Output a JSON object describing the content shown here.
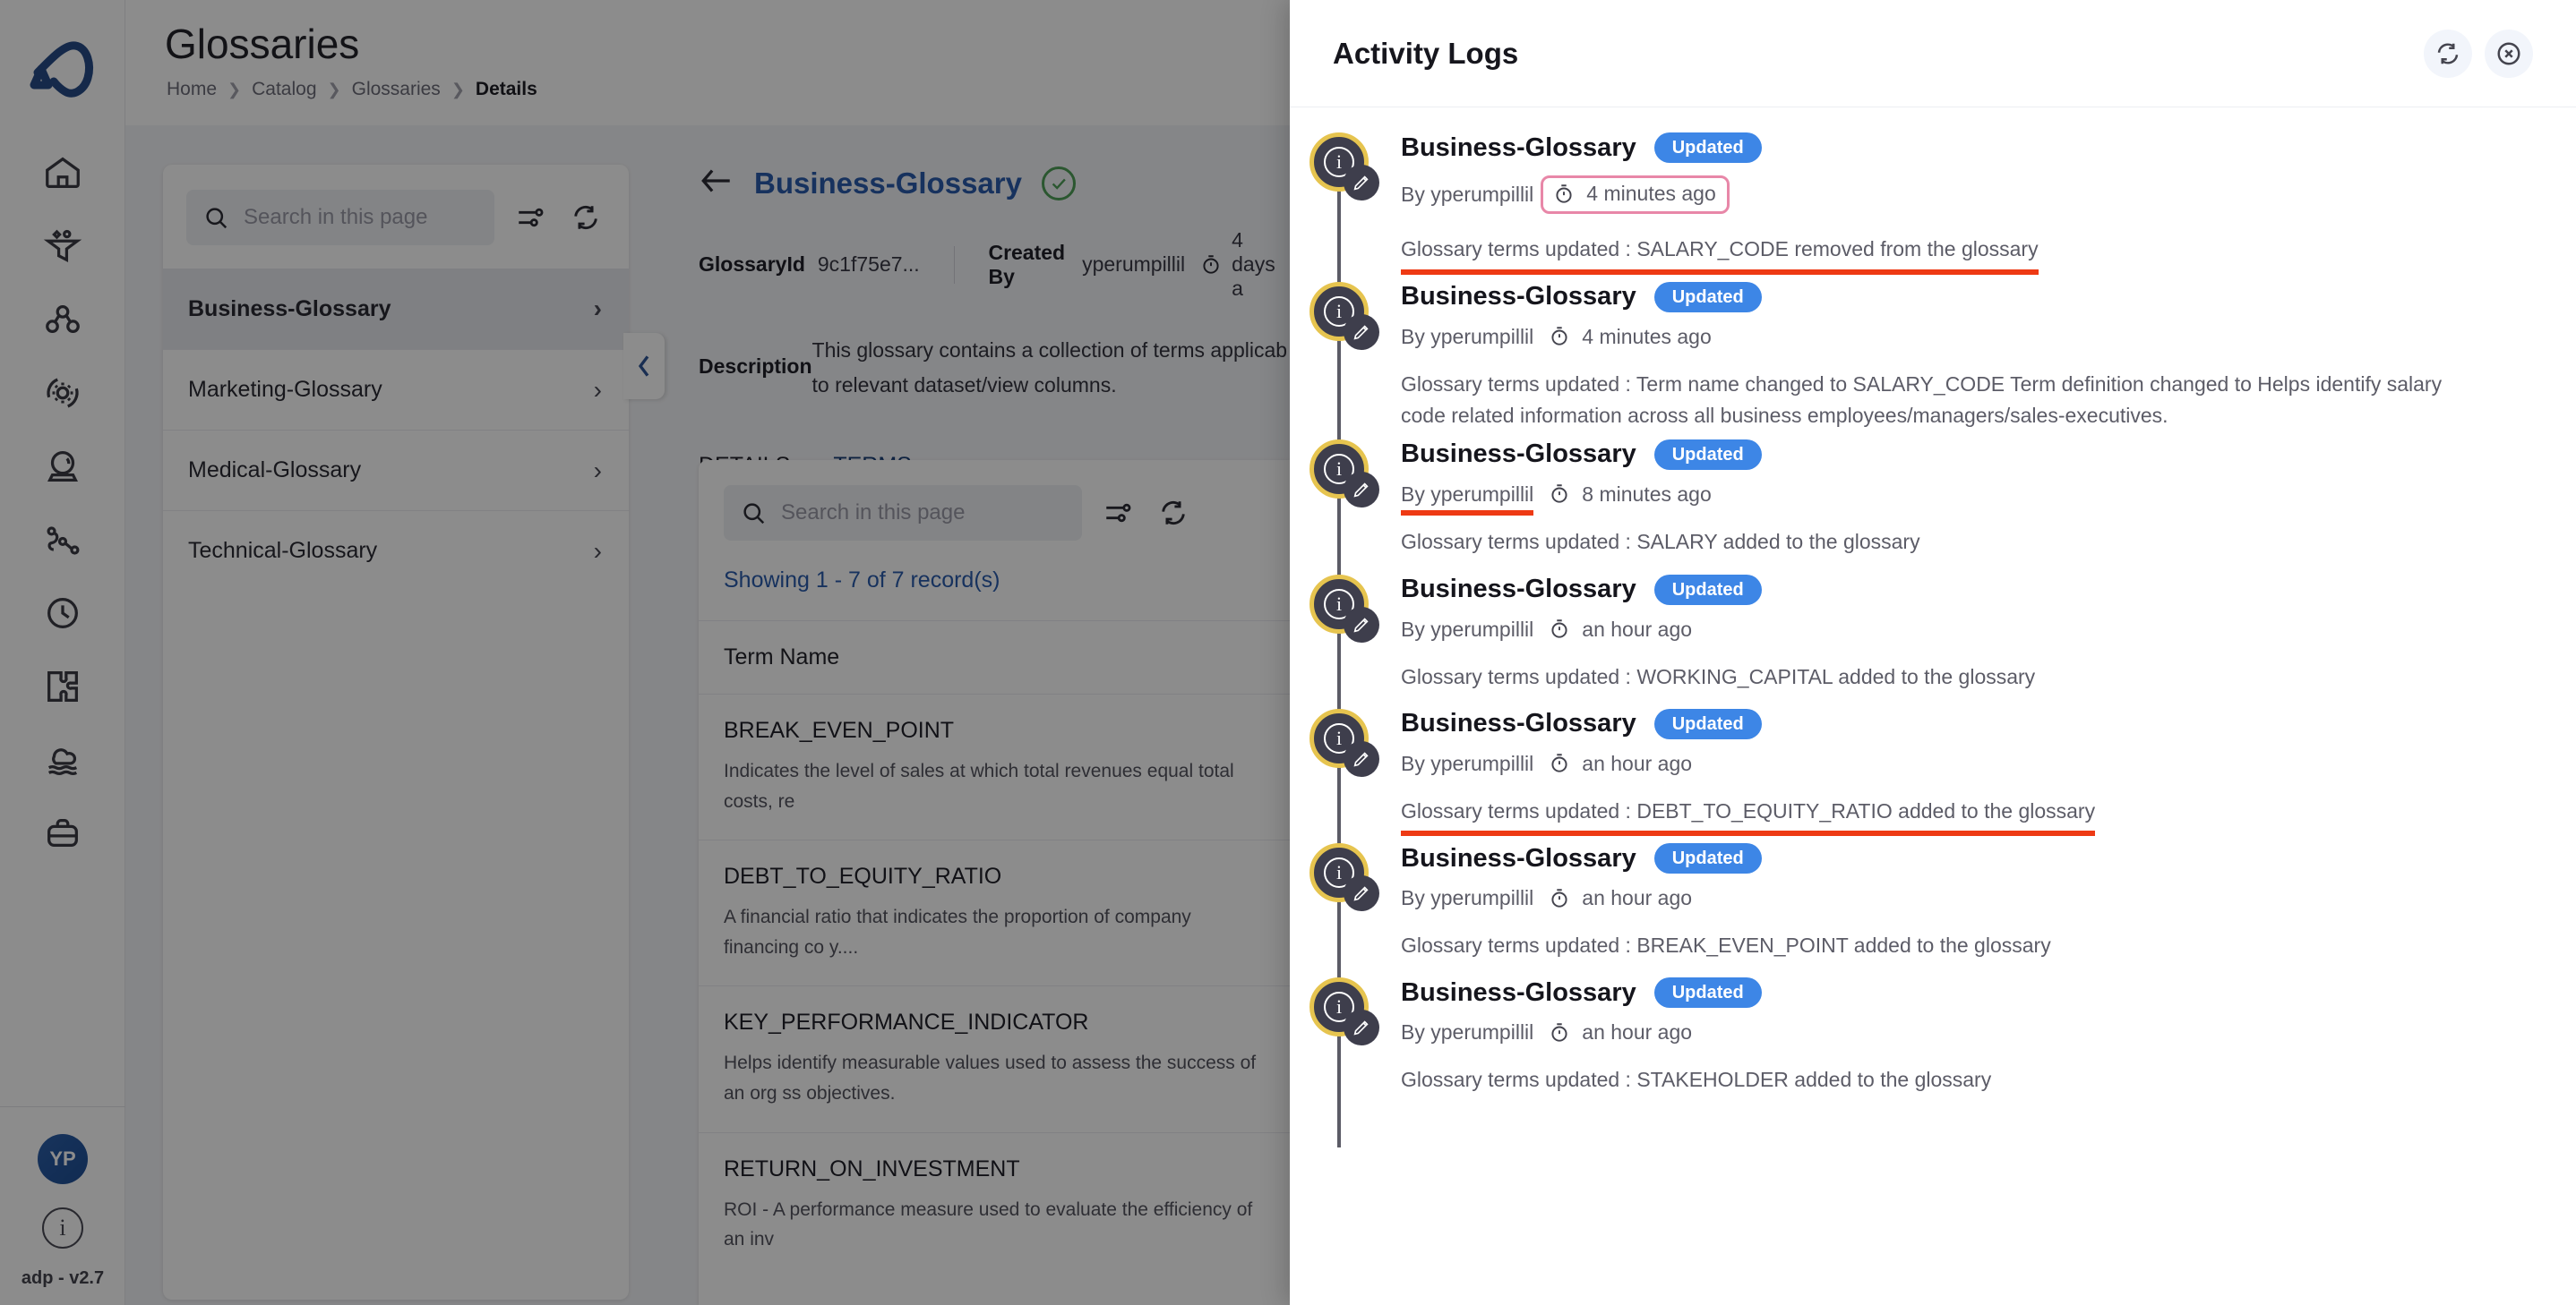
{
  "app": {
    "version_label": "adp - v2.7",
    "avatar_initials": "YP",
    "rail_items": [
      {
        "name": "home-icon",
        "label": "Home"
      },
      {
        "name": "funnel-icon",
        "label": "Data Pipelines"
      },
      {
        "name": "nodes-icon",
        "label": "Lineage"
      },
      {
        "name": "gear-orbit-icon",
        "label": "Operations"
      },
      {
        "name": "crystal-ball-icon",
        "label": "Insights"
      },
      {
        "name": "flow-path-icon",
        "label": "Workflows"
      },
      {
        "name": "clock-icon",
        "label": "Schedules"
      },
      {
        "name": "puzzle-icon",
        "label": "Integrations"
      },
      {
        "name": "cloud-data-icon",
        "label": "Cloud"
      },
      {
        "name": "briefcase-icon",
        "label": "Catalog"
      }
    ]
  },
  "header": {
    "title": "Glossaries",
    "breadcrumbs": [
      "Home",
      "Catalog",
      "Glossaries",
      "Details"
    ],
    "breadcrumb_current": "Details"
  },
  "glossary_panel": {
    "search_placeholder": "Search in this page",
    "filter_icon": "filter-settings-icon",
    "refresh_icon": "refresh-icon",
    "items": [
      {
        "label": "Business-Glossary",
        "selected": true
      },
      {
        "label": "Marketing-Glossary",
        "selected": false
      },
      {
        "label": "Medical-Glossary",
        "selected": false
      },
      {
        "label": "Technical-Glossary",
        "selected": false
      }
    ]
  },
  "detail": {
    "title": "Business-Glossary",
    "verified": true,
    "glossary_id_label": "GlossaryId",
    "glossary_id_value": "9c1f75e7...",
    "created_by_label": "Created By",
    "created_by_value": "yperumpillil",
    "created_ago": "4 days a",
    "description_label": "Description",
    "description_value": "This glossary contains a collection of terms applicab to relevant dataset/view columns.",
    "tabs": [
      {
        "label": "DETAILS",
        "active": false
      },
      {
        "label": "TERMS",
        "active": true
      }
    ]
  },
  "terms": {
    "search_placeholder": "Search in this page",
    "showing": "Showing 1 - 7 of 7 record(s)",
    "column_header": "Term Name",
    "rows": [
      {
        "name": "BREAK_EVEN_POINT",
        "description": "Indicates the level of sales at which total revenues equal total costs, re"
      },
      {
        "name": "DEBT_TO_EQUITY_RATIO",
        "description": "A financial ratio that indicates the proportion of company financing co y...."
      },
      {
        "name": "KEY_PERFORMANCE_INDICATOR",
        "description": "Helps identify measurable values used to assess the success of an org ss objectives."
      },
      {
        "name": "RETURN_ON_INVESTMENT",
        "description": "ROI - A performance measure used to evaluate the efficiency of an inv"
      }
    ]
  },
  "activity_panel": {
    "title": "Activity Logs",
    "refresh_icon": "refresh-icon",
    "close_icon": "close-icon",
    "entries": [
      {
        "name": "Business-Glossary",
        "badge": "Updated",
        "by_prefix": "By",
        "by_user": "yperumpillil",
        "time": "4 minutes ago",
        "description": "Glossary terms updated : SALARY_CODE removed from the glossary",
        "annotation": {
          "time_boxed": true,
          "desc_underlined": true,
          "by_underlined": false
        }
      },
      {
        "name": "Business-Glossary",
        "badge": "Updated",
        "by_prefix": "By",
        "by_user": "yperumpillil",
        "time": "4 minutes ago",
        "description": "Glossary terms updated : Term name changed to SALARY_CODE Term definition changed to Helps identify salary code related information across all business employees/managers/sales-executives.",
        "annotation": {
          "time_boxed": false,
          "desc_underlined": false,
          "by_underlined": false
        }
      },
      {
        "name": "Business-Glossary",
        "badge": "Updated",
        "by_prefix": "By",
        "by_user": "yperumpillil",
        "time": "8 minutes ago",
        "description": "Glossary terms updated : SALARY added to the glossary",
        "annotation": {
          "time_boxed": false,
          "desc_underlined": false,
          "by_underlined": true
        }
      },
      {
        "name": "Business-Glossary",
        "badge": "Updated",
        "by_prefix": "By",
        "by_user": "yperumpillil",
        "time": "an hour ago",
        "description": "Glossary terms updated : WORKING_CAPITAL added to the glossary",
        "annotation": {
          "time_boxed": false,
          "desc_underlined": false,
          "by_underlined": false
        }
      },
      {
        "name": "Business-Glossary",
        "badge": "Updated",
        "by_prefix": "By",
        "by_user": "yperumpillil",
        "time": "an hour ago",
        "description": "Glossary terms updated : DEBT_TO_EQUITY_RATIO added to the glossary",
        "annotation": {
          "time_boxed": false,
          "desc_underlined": true,
          "by_underlined": false
        }
      },
      {
        "name": "Business-Glossary",
        "badge": "Updated",
        "by_prefix": "By",
        "by_user": "yperumpillil",
        "time": "an hour ago",
        "description": "Glossary terms updated : BREAK_EVEN_POINT added to the glossary",
        "annotation": {
          "time_boxed": false,
          "desc_underlined": false,
          "by_underlined": false
        }
      },
      {
        "name": "Business-Glossary",
        "badge": "Updated",
        "by_prefix": "By",
        "by_user": "yperumpillil",
        "time": "an hour ago",
        "description": "Glossary terms updated : STAKEHOLDER added to the glossary",
        "annotation": {
          "time_boxed": false,
          "desc_underlined": false,
          "by_underlined": false
        }
      }
    ]
  },
  "colors": {
    "accent_blue": "#2a5cab",
    "badge_blue": "#3d86e6",
    "marker_ring": "#e6c44f",
    "marker_fill": "#3e3e4c",
    "annotation_red": "#ee3a14",
    "annotation_pink": "#e887a8",
    "verified_green": "#4f9e58"
  }
}
